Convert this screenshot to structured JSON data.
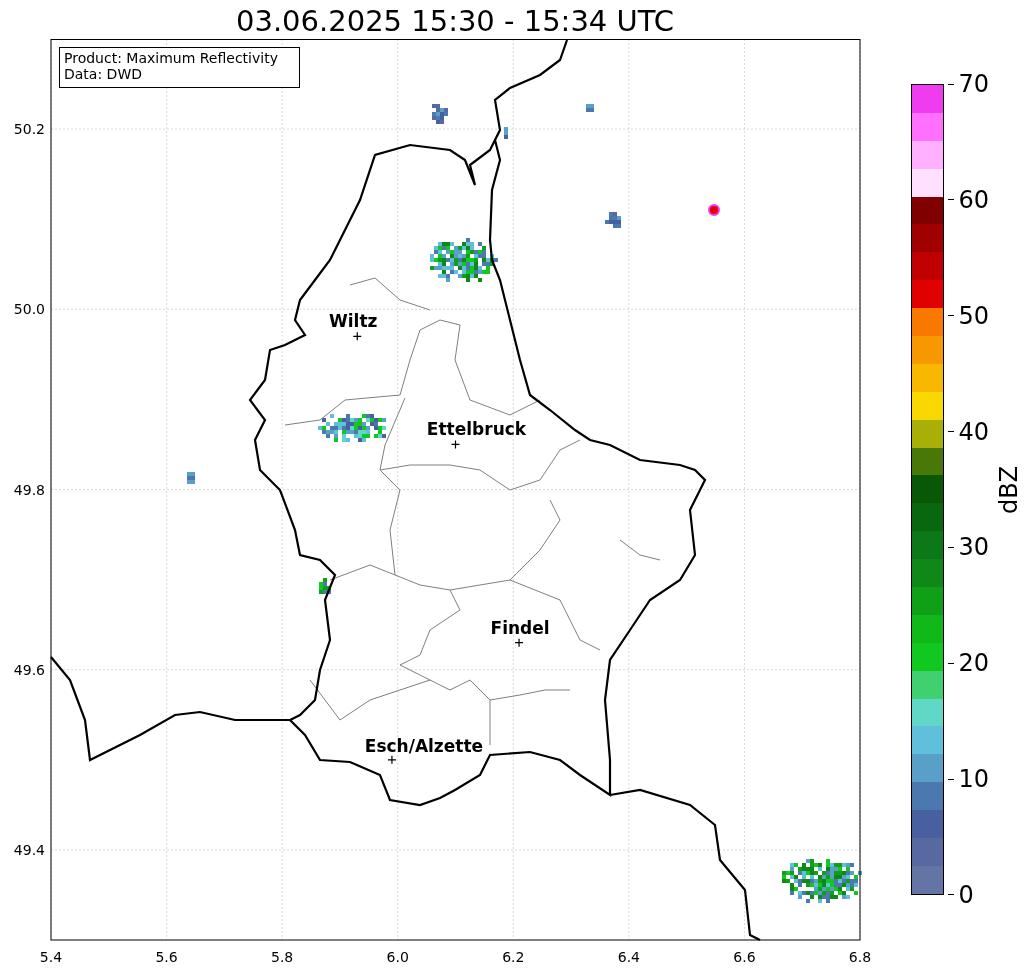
{
  "title": "03.06.2025 15:30 - 15:34 UTC",
  "plot": {
    "info_box": [
      "Product: Maximum Reflectivity",
      "Data: DWD"
    ],
    "chart_data": {
      "type": "scatter",
      "grid": true,
      "xlim": [
        5.4,
        6.8
      ],
      "ylim": [
        49.3,
        50.3
      ],
      "xticks": [
        {
          "value": 5.4,
          "label": "5.4"
        },
        {
          "value": 5.6,
          "label": "5.6"
        },
        {
          "value": 5.8,
          "label": "5.8"
        },
        {
          "value": 6.0,
          "label": "6.0"
        },
        {
          "value": 6.2,
          "label": "6.2"
        },
        {
          "value": 6.4,
          "label": "6.4"
        },
        {
          "value": 6.6,
          "label": "6.6"
        },
        {
          "value": 6.8,
          "label": "6.8"
        }
      ],
      "yticks": [
        {
          "value": 49.4,
          "label": "49.4"
        },
        {
          "value": 49.6,
          "label": "49.6"
        },
        {
          "value": 49.8,
          "label": "49.8"
        },
        {
          "value": 50.0,
          "label": "50.0"
        },
        {
          "value": 50.2,
          "label": "50.2"
        }
      ],
      "x": [
        5.93,
        6.1,
        6.21,
        5.99
      ],
      "series": [
        {
          "color": "#000000",
          "values": [
            49.97,
            49.85,
            49.63,
            49.5
          ]
        }
      ],
      "annotations": [
        "Wiltz",
        "Ettelbruck",
        "Findel",
        "Esch/Alzette"
      ]
    }
  },
  "colorbar": {
    "label": "dBZ",
    "ticks": [
      "70",
      "60",
      "50",
      "40",
      "30",
      "20",
      "10",
      "0"
    ],
    "segments": [
      {
        "color": "#f03cf0"
      },
      {
        "color": "#ff70ff"
      },
      {
        "color": "#ffb0ff"
      },
      {
        "color": "#ffe0ff"
      },
      {
        "color": "#800000"
      },
      {
        "color": "#a00000"
      },
      {
        "color": "#c00000"
      },
      {
        "color": "#e00000"
      },
      {
        "color": "#f87800"
      },
      {
        "color": "#f89800"
      },
      {
        "color": "#f8b800"
      },
      {
        "color": "#f8d800"
      },
      {
        "color": "#a8b008"
      },
      {
        "color": "#487808"
      },
      {
        "color": "#085808"
      },
      {
        "color": "#086810"
      },
      {
        "color": "#0c7818"
      },
      {
        "color": "#108818"
      },
      {
        "color": "#10a018"
      },
      {
        "color": "#10b818"
      },
      {
        "color": "#10c820"
      },
      {
        "color": "#40d070"
      },
      {
        "color": "#60d8c8"
      },
      {
        "color": "#60c0dc"
      },
      {
        "color": "#58a0c8"
      },
      {
        "color": "#4c78b0"
      },
      {
        "color": "#4860a0"
      },
      {
        "color": "#5868a0"
      },
      {
        "color": "#6474a4"
      }
    ]
  }
}
